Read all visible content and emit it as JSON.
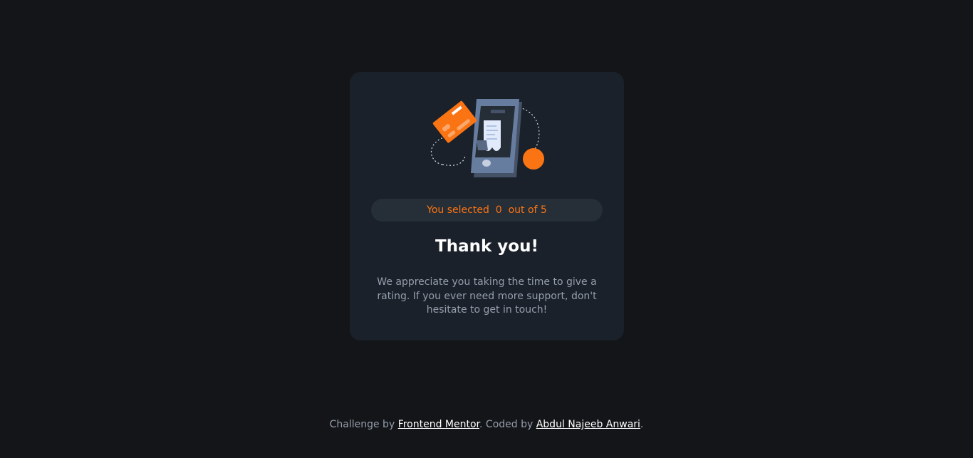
{
  "card": {
    "illustration_icon": "payment-phone-illustration",
    "selected_prefix": "You selected",
    "selected_value": "0",
    "selected_suffix": "out of 5",
    "title": "Thank you!",
    "body": "We appreciate you taking the time to give a rating. If you ever need more support, don't hesitate to get in touch!"
  },
  "footer": {
    "prefix": "Challenge by",
    "link1": "Frontend Mentor",
    "middle": ". Coded by",
    "link2": "Abdul Najeeb Anwari",
    "suffix": "."
  },
  "colors": {
    "background": "#131518",
    "card": "#1a212a",
    "accent": "#fb7413",
    "muted_text": "#959eac",
    "pill": "#262e38"
  }
}
